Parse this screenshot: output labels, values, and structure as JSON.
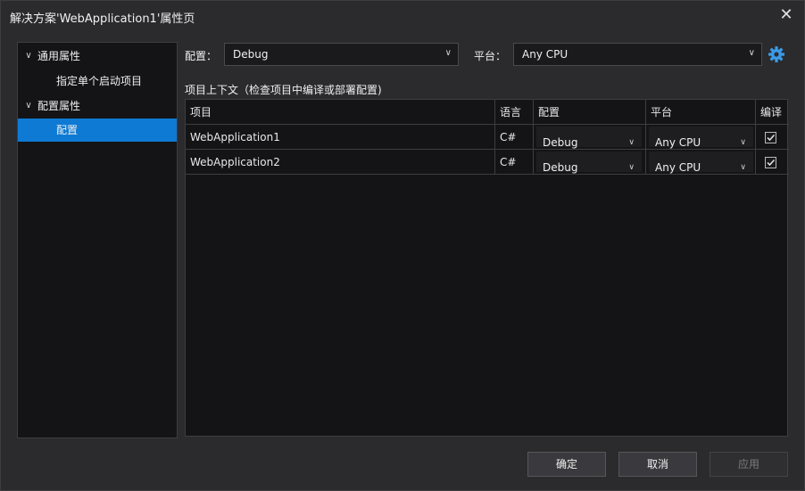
{
  "window": {
    "title": "解决方案'WebApplication1'属性页",
    "close_icon": "close-icon"
  },
  "tree": {
    "items": [
      {
        "label": "通用属性",
        "expanded": true
      },
      {
        "label": "指定单个启动项目"
      },
      {
        "label": "配置属性",
        "expanded": true
      },
      {
        "label": "配置",
        "selected": true
      }
    ]
  },
  "config": {
    "label": "配置：",
    "value": "Debug",
    "platform_label": "平台：",
    "platform_value": "Any CPU",
    "settings_icon": "gear-icon"
  },
  "context": {
    "label": "项目上下文（检查项目中编译或部署配置)",
    "headers": [
      "项目",
      "语言",
      "配置",
      "平台",
      "编译"
    ],
    "rows": [
      {
        "project": "WebApplication1",
        "language": "C#",
        "config": "Debug",
        "platform": "Any CPU",
        "build": true
      },
      {
        "project": "WebApplication2",
        "language": "C#",
        "config": "Debug",
        "platform": "Any CPU",
        "build": true
      }
    ]
  },
  "buttons": {
    "ok": "确定",
    "cancel": "取消",
    "apply": "应用"
  },
  "colors": {
    "accent": "#0e7ad3",
    "gear": "#3b9be8"
  }
}
